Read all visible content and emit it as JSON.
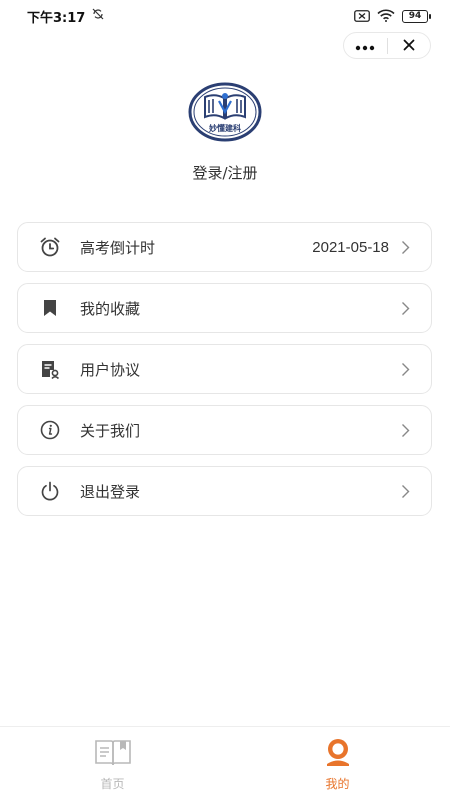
{
  "status_bar": {
    "time": "下午3:17",
    "battery": "94"
  },
  "header": {
    "login_text": "登录/注册"
  },
  "logo": {
    "text": "妙懂建科"
  },
  "menu": {
    "items": [
      {
        "label": "高考倒计时",
        "value": "2021-05-18",
        "icon": "alarm-clock-icon"
      },
      {
        "label": "我的收藏",
        "value": "",
        "icon": "bookmark-icon"
      },
      {
        "label": "用户协议",
        "value": "",
        "icon": "document-icon"
      },
      {
        "label": "关于我们",
        "value": "",
        "icon": "info-icon"
      },
      {
        "label": "退出登录",
        "value": "",
        "icon": "power-icon"
      }
    ]
  },
  "tabbar": {
    "home_label": "首页",
    "mine_label": "我的",
    "active_color": "#e8742b",
    "inactive_color": "#b8b8b8"
  }
}
